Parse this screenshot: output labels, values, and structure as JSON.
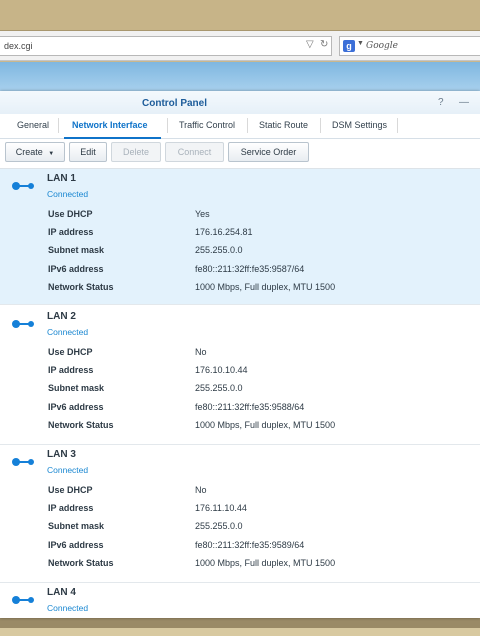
{
  "browser": {
    "url": "dex.cgi",
    "search_placeholder": "Google"
  },
  "window": {
    "title": "Control Panel",
    "help_icon": "?",
    "minimize_icon": "—"
  },
  "tabs": [
    {
      "label": "General"
    },
    {
      "label": "Network Interface"
    },
    {
      "label": "Traffic Control"
    },
    {
      "label": "Static Route"
    },
    {
      "label": "DSM Settings"
    }
  ],
  "toolbar": {
    "create": "Create",
    "edit": "Edit",
    "delete": "Delete",
    "connect": "Connect",
    "service_order": "Service Order"
  },
  "labels": {
    "dhcp": "Use DHCP",
    "ip": "IP address",
    "mask": "Subnet mask",
    "ipv6": "IPv6 address",
    "status": "Network Status"
  },
  "interfaces": [
    {
      "name": "LAN 1",
      "status": "Connected",
      "dhcp": "Yes",
      "ip": "176.16.254.81",
      "mask": "255.255.0.0",
      "ipv6": "fe80::211:32ff:fe35:9587/64",
      "net": "1000 Mbps, Full duplex, MTU 1500"
    },
    {
      "name": "LAN 2",
      "status": "Connected",
      "dhcp": "No",
      "ip": "176.10.10.44",
      "mask": "255.255.0.0",
      "ipv6": "fe80::211:32ff:fe35:9588/64",
      "net": "1000 Mbps, Full duplex, MTU 1500"
    },
    {
      "name": "LAN 3",
      "status": "Connected",
      "dhcp": "No",
      "ip": "176.11.10.44",
      "mask": "255.255.0.0",
      "ipv6": "fe80::211:32ff:fe35:9589/64",
      "net": "1000 Mbps, Full duplex, MTU 1500"
    },
    {
      "name": "LAN 4",
      "status": "Connected"
    }
  ]
}
